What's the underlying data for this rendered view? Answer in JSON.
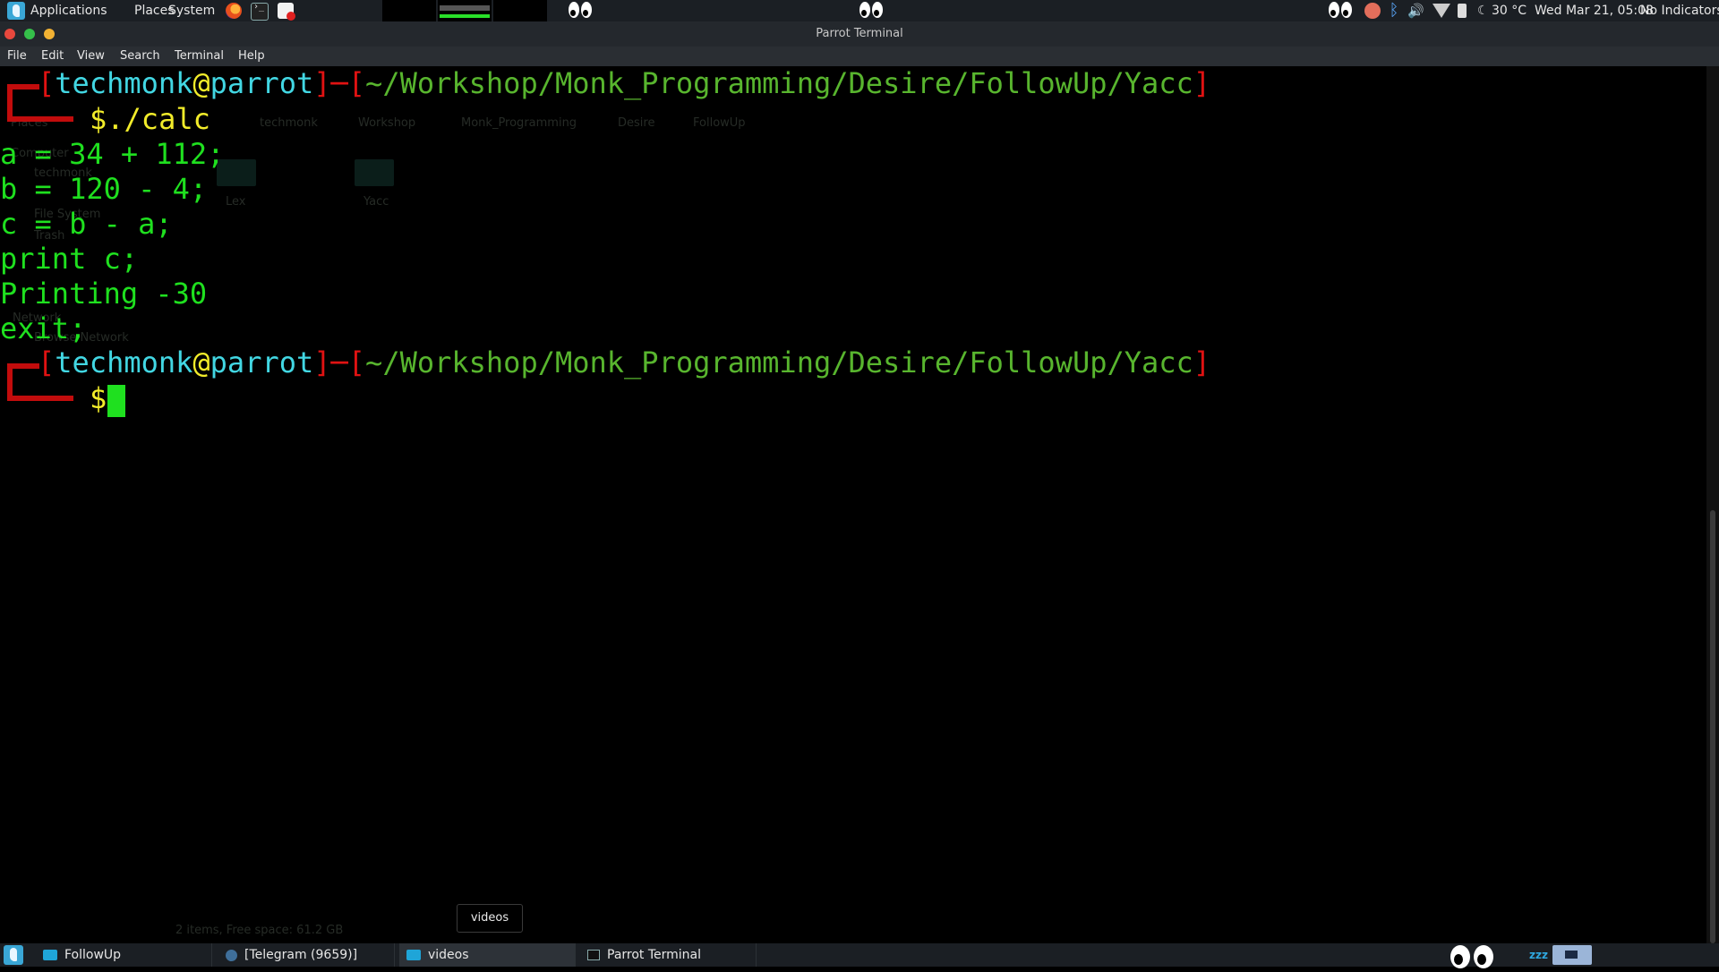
{
  "top_panel": {
    "menus": [
      "Applications",
      "Places",
      "System"
    ],
    "launchers": [
      "firefox-icon",
      "terminal-icon",
      "document-viewer-icon"
    ],
    "weather": "30 °C",
    "clock": "Wed Mar 21, 05:08",
    "indicators": "No Indicators"
  },
  "window": {
    "title": "Parrot Terminal",
    "menu": {
      "file": "File",
      "edit": "Edit",
      "view": "View",
      "search": "Search",
      "terminal": "Terminal",
      "help": "Help"
    }
  },
  "terminal": {
    "prompt": {
      "bracket_open": "[",
      "user": "techmonk",
      "at": "@",
      "host": "parrot",
      "bracket_close": "]",
      "dash": "─",
      "path": "~/Workshop/Monk_Programming/Desire/FollowUp/Yacc",
      "symbol": "$"
    },
    "command": "./calc",
    "output_lines": [
      "a = 34 + 112;",
      "b = 120 - 4;",
      "c = b - a;",
      "print c;",
      "Printing -30",
      "exit;"
    ],
    "colors": {
      "text_green": "#1fe01f",
      "prompt_red": "#e01212",
      "user_cyan": "#42d7e3",
      "dollar_yellow": "#f2ec2a",
      "path_green": "#58b52e"
    }
  },
  "background_ghost": {
    "breadcrumb": [
      "techmonk",
      "Workshop",
      "Monk_Programming",
      "Desire",
      "FollowUp"
    ],
    "sidebar": [
      "Places",
      "Computer",
      "techmonk",
      "File System",
      "Trash",
      "Network",
      "Browse Network"
    ],
    "folders": [
      "Lex",
      "Yacc"
    ],
    "status": "2 items, Free space: 61.2 GB"
  },
  "tooltip": "videos",
  "taskbar": {
    "tasks": [
      {
        "label": "FollowUp",
        "icon": "folder-icon"
      },
      {
        "label": "[Telegram (9659)]",
        "icon": "telegram-icon"
      },
      {
        "label": "videos",
        "icon": "folder-icon"
      },
      {
        "label": "Parrot Terminal",
        "icon": "terminal-icon"
      }
    ],
    "sleep_indicator": "zzz"
  }
}
